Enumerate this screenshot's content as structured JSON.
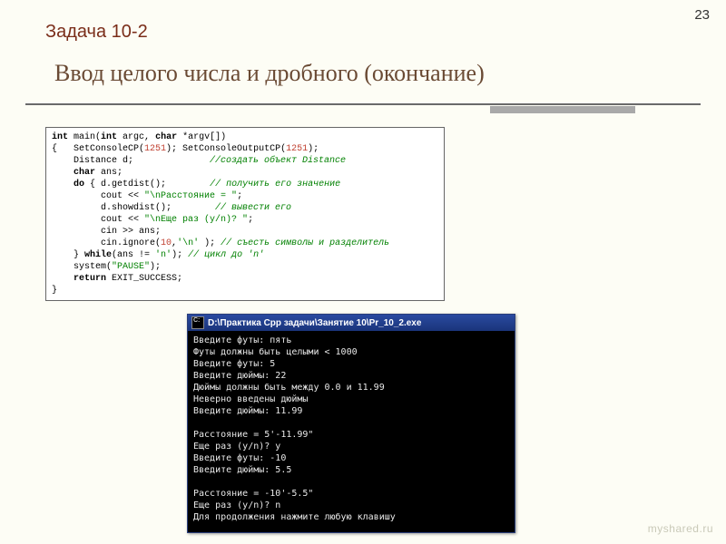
{
  "page_number": "23",
  "task_label": "Задача 10-2",
  "heading": "Ввод целого числа и дробного (окончание)",
  "code": {
    "kw_int": "int",
    "main_sig_a": " main(",
    "main_sig_b": " argc, ",
    "kw_char1": "char",
    "main_sig_c": " *argv[])",
    "l2a": "{   SetConsoleCP(",
    "n1251a": "1251",
    "l2b": "); SetConsoleOutputCP(",
    "n1251b": "1251",
    "l2c": ");",
    "l3a": "    Distance d;              ",
    "c3": "//создать объект Distance",
    "l4a": "    ",
    "kw_char2": "char",
    "l4b": " ans;",
    "l5a": "    ",
    "kw_do": "do",
    "l5b": " { d.getdist();        ",
    "c5": "// получить его значение",
    "l6a": "         cout << ",
    "s6": "\"\\nРасстояние = \"",
    "l6b": ";",
    "l7a": "         d.showdist();        ",
    "c7": "// вывести его",
    "l8a": "         cout << ",
    "s8": "\"\\nЕще раз (y/n)? \"",
    "l8b": ";",
    "l9": "         cin >> ans;",
    "l10a": "         cin.ignore(",
    "n10": "10",
    "l10b": ",",
    "s10": "'\\n'",
    "l10c": " ); ",
    "c10": "// съесть символы и разделитель",
    "l11a": "    } ",
    "kw_while": "while",
    "l11b": "(ans != ",
    "s11": "'n'",
    "l11c": "); ",
    "c11": "// цикл до 'n'",
    "l12a": "    system(",
    "s12": "\"PAUSE\"",
    "l12b": ");",
    "l13a": "    ",
    "kw_return": "return",
    "l13b": " EXIT_SUCCESS;",
    "l14": "}"
  },
  "console": {
    "title": "D:\\Практика Cpp задачи\\Занятие 10\\Pr_10_2.exe",
    "lines": [
      "Введите футы: пять",
      "Футы должны быть целыми < 1000",
      "Введите футы: 5",
      "Введите дюймы: 22",
      "Дюймы должны быть между 0.0 и 11.99",
      "Неверно введены дюймы",
      "Введите дюймы: 11.99",
      "",
      "Расстояние = 5'-11.99\"",
      "Еще раз (y/n)? y",
      "Введите футы: -10",
      "Введите дюймы: 5.5",
      "",
      "Расстояние = -10'-5.5\"",
      "Еще раз (y/n)? n",
      "Для продолжения нажмите любую клавишу"
    ]
  },
  "watermark": "myshared.ru"
}
